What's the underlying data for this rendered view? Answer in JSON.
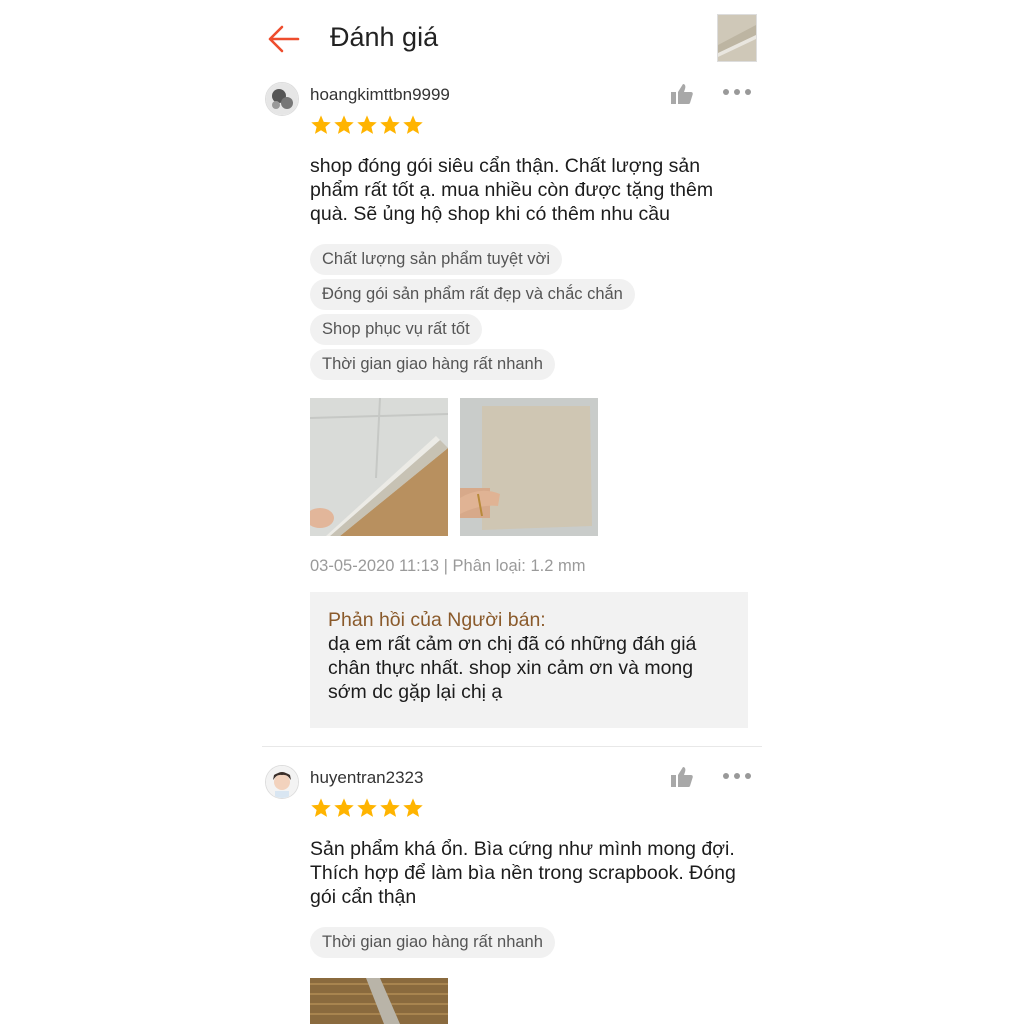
{
  "header": {
    "title": "Đánh giá"
  },
  "reviews": [
    {
      "username": "hoangkimttbn9999",
      "rating": 5,
      "content": "shop đóng gói siêu cẩn thận. Chất lượng sản phẩm rất tốt ạ. mua nhiều còn được tặng thêm quà. Sẽ ủng hộ shop khi có thêm nhu cầu",
      "tags": [
        "Chất lượng sản phẩm tuyệt vời",
        "Đóng gói sản phẩm rất đẹp và chắc chắn",
        "Shop phục vụ rất tốt",
        "Thời gian giao hàng rất nhanh"
      ],
      "meta": "03-05-2020 11:13 | Phân loại: 1.2 mm",
      "reply": {
        "title": "Phản hồi của Người bán:",
        "text": "dạ em rất cảm ơn chị đã có những đáh giá chân thực nhất. shop xin cảm ơn và mong sớm dc gặp lại chị ạ"
      }
    },
    {
      "username": "huyentran2323",
      "rating": 5,
      "content": "Sản phẩm khá ổn. Bìa cứng như mình mong đợi. Thích hợp để làm bìa nền trong scrapbook. Đóng gói cẩn thận",
      "tags": [
        "Thời gian giao hàng rất nhanh"
      ]
    }
  ],
  "icons": {
    "back": "arrow-left-icon",
    "like": "thumbs-up-icon",
    "more": "more-horizontal-icon",
    "star": "star-icon"
  },
  "colors": {
    "accent": "#ee4d2d",
    "star": "#ffb400",
    "reply_title": "#8a5a2b",
    "meta": "#9a9a9a",
    "tag_bg": "#f1f1f1"
  }
}
